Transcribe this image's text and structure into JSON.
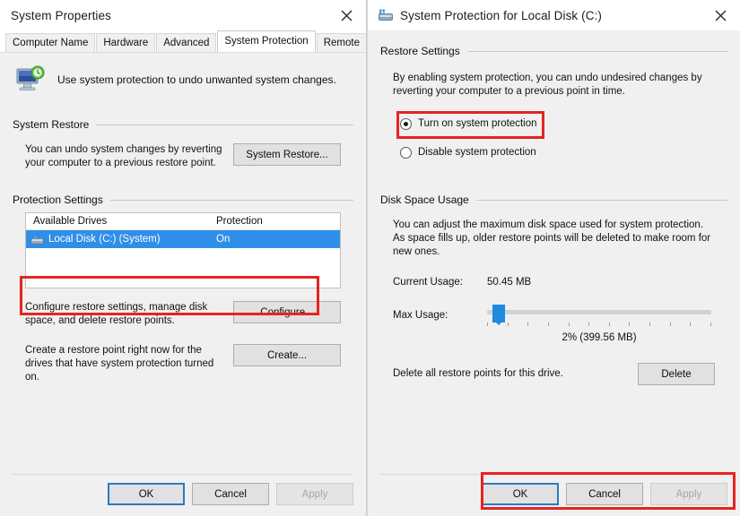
{
  "left_dialog": {
    "title": "System Properties",
    "close_label": "✕",
    "tabs": [
      {
        "label": "Computer Name",
        "active": false
      },
      {
        "label": "Hardware",
        "active": false
      },
      {
        "label": "Advanced",
        "active": false
      },
      {
        "label": "System Protection",
        "active": true
      },
      {
        "label": "Remote",
        "active": false
      }
    ],
    "intro_text": "Use system protection to undo unwanted system changes.",
    "system_restore": {
      "group_title": "System Restore",
      "description": "You can undo system changes by reverting your computer to a previous restore point.",
      "button": "System Restore..."
    },
    "protection_settings": {
      "group_title": "Protection Settings",
      "columns": [
        "Available Drives",
        "Protection"
      ],
      "rows": [
        {
          "drive": "Local Disk (C:) (System)",
          "protection": "On",
          "selected": true
        }
      ],
      "configure": {
        "description": "Configure restore settings, manage disk space, and delete restore points.",
        "button": "Configure..."
      },
      "create": {
        "description": "Create a restore point right now for the drives that have system protection turned on.",
        "button": "Create..."
      }
    },
    "footer": {
      "ok": "OK",
      "cancel": "Cancel",
      "apply": "Apply",
      "apply_disabled": true
    }
  },
  "right_dialog": {
    "title": "System Protection for Local Disk (C:)",
    "close_label": "✕",
    "restore_settings": {
      "group_title": "Restore Settings",
      "description": "By enabling system protection, you can undo undesired changes by reverting your computer to a previous point in time.",
      "options": [
        {
          "label": "Turn on system protection",
          "checked": true
        },
        {
          "label": "Disable system protection",
          "checked": false
        }
      ]
    },
    "disk_space_usage": {
      "group_title": "Disk Space Usage",
      "description": "You can adjust the maximum disk space used for system protection. As space fills up, older restore points will be deleted to make room for new ones.",
      "current_usage_label": "Current Usage:",
      "current_usage_value": "50.45 MB",
      "max_usage_label": "Max Usage:",
      "max_usage_percent": 2,
      "max_usage_value": "2% (399.56 MB)"
    },
    "delete_section": {
      "description": "Delete all restore points for this drive.",
      "button": "Delete"
    },
    "footer": {
      "ok": "OK",
      "cancel": "Cancel",
      "apply": "Apply",
      "apply_disabled": true
    }
  },
  "annotations": {
    "color": "#e52421",
    "boxes": [
      {
        "name": "drive-list-highlight"
      },
      {
        "name": "turn-on-protection-highlight"
      },
      {
        "name": "right-footer-buttons-highlight"
      }
    ]
  }
}
